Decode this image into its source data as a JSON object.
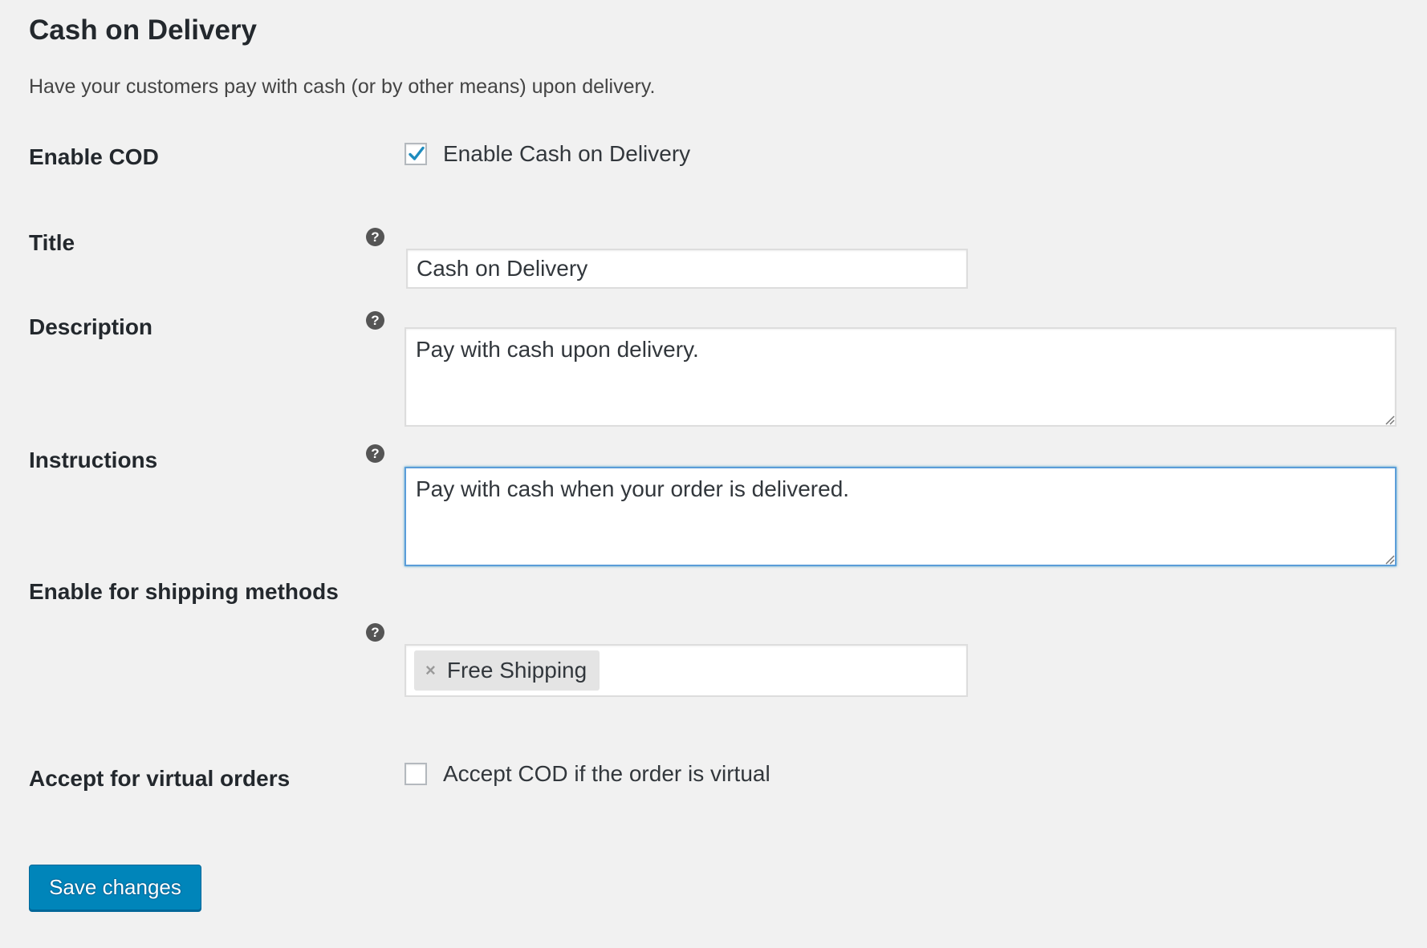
{
  "page": {
    "title": "Cash on Delivery",
    "description": "Have your customers pay with cash (or by other means) upon delivery."
  },
  "settings": {
    "enable_cod": {
      "label": "Enable COD",
      "checkbox_label": "Enable Cash on Delivery",
      "checked": true
    },
    "title": {
      "label": "Title",
      "help_icon": "?",
      "value": "Cash on Delivery"
    },
    "description": {
      "label": "Description",
      "help_icon": "?",
      "value": "Pay with cash upon delivery."
    },
    "instructions": {
      "label": "Instructions",
      "help_icon": "?",
      "value": "Pay with cash when your order is delivered.",
      "focused": true
    },
    "shipping_methods": {
      "label": "Enable for shipping methods",
      "help_icon": "?",
      "selected": [
        {
          "label": "Free Shipping",
          "remove_icon": "×"
        }
      ]
    },
    "virtual_orders": {
      "label": "Accept for virtual orders",
      "checkbox_label": "Accept COD if the order is virtual",
      "checked": false
    }
  },
  "actions": {
    "save_label": "Save changes"
  },
  "colors": {
    "background": "#f1f1f1",
    "primary_button": "#0085ba",
    "focus_border": "#5b9dd9",
    "checkmark": "#1e8cbe"
  },
  "icons": {
    "help": "help-circle-icon",
    "check": "checkmark-icon",
    "remove": "close-icon",
    "resize": "resize-grip-icon"
  }
}
